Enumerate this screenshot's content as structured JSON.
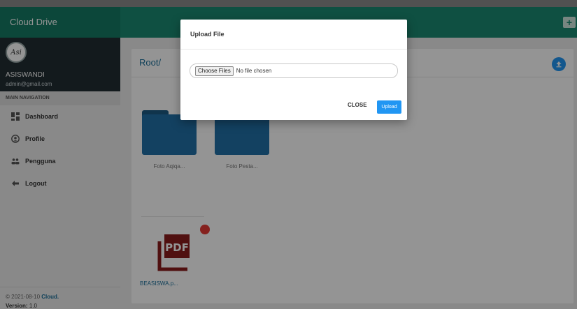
{
  "header": {
    "brand": "Cloud Drive",
    "add_folder_icon": "add-folder-icon"
  },
  "sidebar": {
    "user_name": "ASISWANDI",
    "user_email": "admin@gmail.com",
    "avatar_text": "Asi",
    "nav_header": "MAIN NAVIGATION",
    "items": [
      {
        "label": "Dashboard",
        "icon": "dashboard-icon"
      },
      {
        "label": "Profile",
        "icon": "profile-icon"
      },
      {
        "label": "Pengguna",
        "icon": "users-icon"
      },
      {
        "label": "Logout",
        "icon": "logout-icon"
      }
    ],
    "footer_date": "© 2021-08-10 ",
    "footer_brand": "Cloud.",
    "version_label": "Version:",
    "version_value": "1.0"
  },
  "main": {
    "breadcrumb": "Root/",
    "files": [
      {
        "name": "Foto Aqiqa...",
        "type": "folder"
      },
      {
        "name": "Foto Pesta...",
        "type": "folder"
      },
      {
        "name": "BEASISWA.p...",
        "type": "pdf",
        "icon_text": "PDF"
      }
    ]
  },
  "modal": {
    "title": "Upload File",
    "choose_label": "Choose Files",
    "no_file_text": "No file chosen",
    "close_label": "CLOSE",
    "upload_label": "Upload"
  },
  "colors": {
    "brand": "#1b8a73",
    "primary": "#2196f3",
    "folder": "#2271a8",
    "pdf": "#8b1d1d"
  }
}
